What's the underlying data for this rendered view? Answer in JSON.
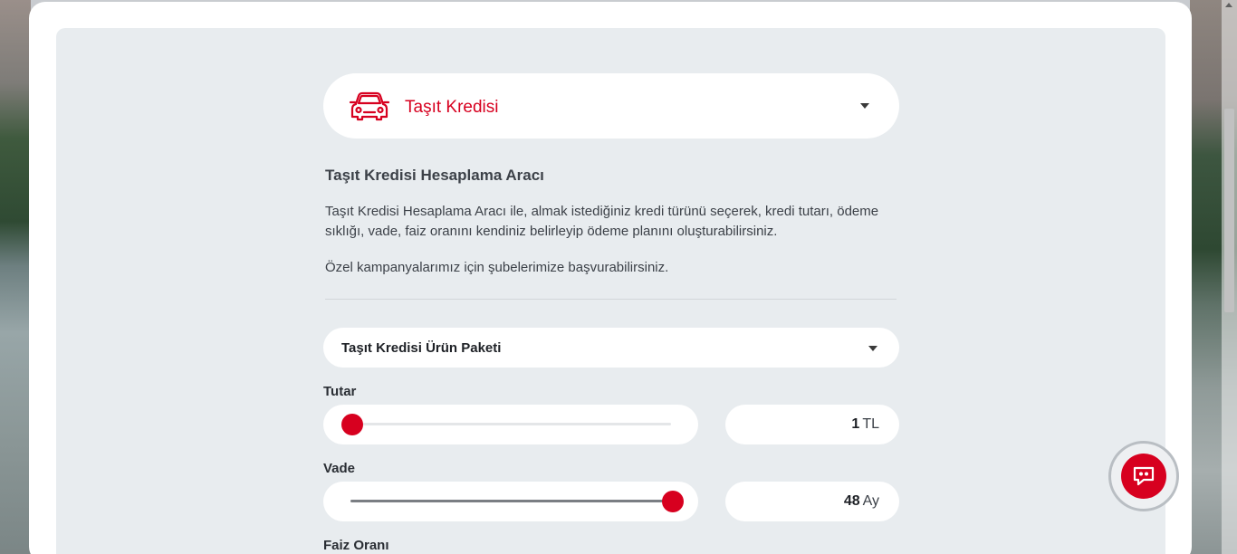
{
  "product": {
    "label": "Taşıt Kredisi",
    "icon": "car-icon"
  },
  "intro": {
    "heading": "Taşıt Kredisi Hesaplama Aracı",
    "description": "Taşıt Kredisi Hesaplama Aracı ile, almak istediğiniz kredi türünü seçerek, kredi tutarı, ödeme sıklığı, vade, faiz oranını kendiniz belirleyip ödeme planını oluşturabilirsiniz.",
    "campaign": "Özel kampanyalarımız için şubelerimize başvurabilirsiniz."
  },
  "package": {
    "label": "Taşıt Kredisi Ürün Paketi"
  },
  "amount": {
    "label": "Tutar",
    "value": "1",
    "unit": "TL",
    "slider_fraction": 0.0
  },
  "term": {
    "label": "Vade",
    "value": "48",
    "unit": "Ay",
    "slider_fraction": 1.0
  },
  "interest": {
    "label": "Faiz Oranı"
  },
  "colors": {
    "accent": "#d7001f",
    "panel": "#e8ecef"
  },
  "chat": {
    "icon": "chat-bubble-icon"
  }
}
